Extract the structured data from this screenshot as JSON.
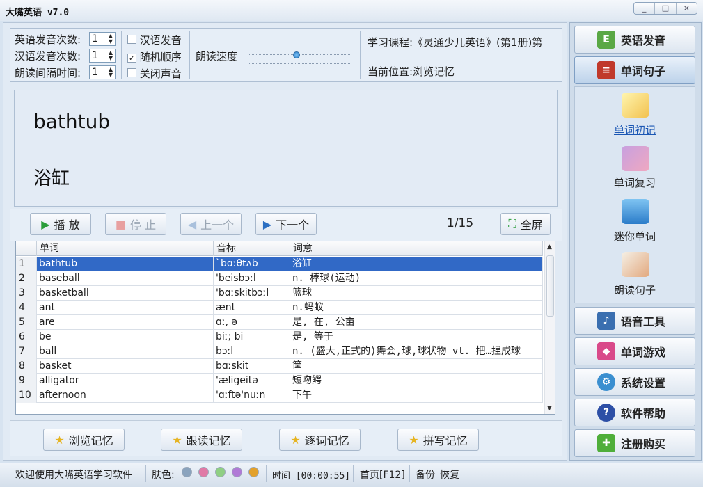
{
  "app": {
    "title": "大嘴英语 v7.0",
    "window_controls": [
      "_",
      "□",
      "×"
    ]
  },
  "settings": {
    "en_times_label": "英语发音次数:",
    "en_times_value": "1",
    "cn_times_label": "汉语发音次数:",
    "cn_times_value": "1",
    "interval_label": "朗读间隔时间:",
    "interval_value": "1",
    "cb_chinese": {
      "label": "汉语发音",
      "checked": false
    },
    "cb_random": {
      "label": "随机顺序",
      "checked": true
    },
    "cb_mute": {
      "label": "关闭声音",
      "checked": false
    },
    "speed_label": "朗读速度",
    "speed_level": 0.47,
    "course_label": "学习课程:《灵通少儿英语》(第1册)第",
    "position_label": "当前位置:浏览记忆"
  },
  "display": {
    "word": "bathtub",
    "meaning": "浴缸"
  },
  "toolbar": {
    "play": "播 放",
    "stop": "停 止",
    "prev": "上一个",
    "next": "下一个",
    "counter": "1/15",
    "fullscreen": "全屏"
  },
  "table": {
    "columns": [
      "单词",
      "音标",
      "词意"
    ],
    "rows": [
      {
        "n": "1",
        "word": "bathtub",
        "ipa": "`bɑːθtʌb",
        "meaning": "浴缸"
      },
      {
        "n": "2",
        "word": "baseball",
        "ipa": "'beisbɔːl",
        "meaning": "n. 棒球(运动)"
      },
      {
        "n": "3",
        "word": "basketball",
        "ipa": "'bɑːskitbɔːl",
        "meaning": "篮球"
      },
      {
        "n": "4",
        "word": "ant",
        "ipa": "ænt",
        "meaning": "n.蚂蚁"
      },
      {
        "n": "5",
        "word": "are",
        "ipa": "ɑː, ə",
        "meaning": "是, 在, 公亩"
      },
      {
        "n": "6",
        "word": "be",
        "ipa": "biː; bi",
        "meaning": "是, 等于"
      },
      {
        "n": "7",
        "word": "ball",
        "ipa": "bɔːl",
        "meaning": "n. (盛大,正式的)舞会,球,球状物 vt. 把…捏成球"
      },
      {
        "n": "8",
        "word": "basket",
        "ipa": "bɑːskit",
        "meaning": "筐"
      },
      {
        "n": "9",
        "word": "alligator",
        "ipa": "'æligeitə",
        "meaning": "短吻鳄"
      },
      {
        "n": "10",
        "word": "afternoon",
        "ipa": "'ɑːftə'nuːn",
        "meaning": "下午"
      }
    ],
    "selected_index": 0
  },
  "memory_modes": [
    "浏览记忆",
    "跟读记忆",
    "逐词记忆",
    "拼写记忆"
  ],
  "status": {
    "welcome": "欢迎使用大嘴英语学习软件",
    "skin_label": "肤色:",
    "skin_colors": [
      "#8aa3bd",
      "#e07aa6",
      "#8fcf83",
      "#b07ad6",
      "#e3a12b"
    ],
    "time": "时间 [00:00:55]",
    "home": "首页[F12]",
    "backup": "备份",
    "restore": "恢复"
  },
  "sidebar": {
    "english_pron": "英语发音",
    "word_sentence": "单词句子",
    "sub_items": [
      "单词初记",
      "单词复习",
      "迷你单词",
      "朗读句子"
    ],
    "voice_tools": "语音工具",
    "word_games": "单词游戏",
    "settings": "系统设置",
    "help": "软件帮助",
    "register": "注册购买"
  },
  "colors": {
    "selection": "#3169c6",
    "accent_link": "#1b57b4"
  }
}
